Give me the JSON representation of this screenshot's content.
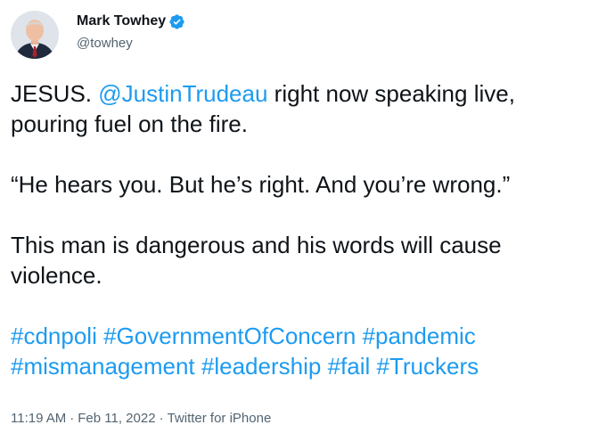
{
  "author": {
    "display_name": "Mark Towhey",
    "handle": "@towhey",
    "verified": true,
    "avatar": "person-photo-avatar"
  },
  "tweet": {
    "p1": {
      "lead": "JESUS. ",
      "mention": "@JustinTrudeau",
      "rest": " right now speaking live, pouring fuel on the fire."
    },
    "p2": "“He hears you. But he’s right. And you’re wrong.”",
    "p3": "This man is dangerous and his words will cause violence.",
    "hashtags": [
      "#cdnpoli",
      "#GovernmentOfConcern",
      "#pandemic",
      "#mismanagement",
      "#leadership",
      "#fail",
      "#Truckers"
    ]
  },
  "meta": {
    "time": "11:19 AM",
    "separator": "·",
    "date": "Feb 11, 2022",
    "source": "Twitter for iPhone"
  },
  "colors": {
    "link": "#1d9bf0",
    "text": "#0f1419",
    "muted": "#536471",
    "verified_badge": "#1d9bf0"
  }
}
